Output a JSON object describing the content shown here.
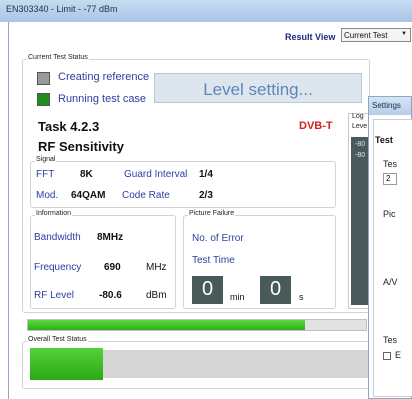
{
  "window": {
    "title": "EN303340 - Limit - -77 dBm"
  },
  "header": {
    "result_view_label": "Result View",
    "result_view_value": "Current Test"
  },
  "current_status": {
    "group_label": "Current Test Status",
    "steps": [
      {
        "label": "Creating reference",
        "checked": false,
        "color": "#9a9a9a"
      },
      {
        "label": "Running test case",
        "checked": true,
        "color": "#1e8f1e"
      }
    ],
    "level_text": "Level setting...",
    "task": "Task 4.2.3",
    "standard": "DVB-T",
    "test_name": "RF Sensitivity"
  },
  "signal": {
    "group_label": "Signal",
    "fft_label": "FFT",
    "fft_value": "8K",
    "guard_label": "Guard Interval",
    "guard_value": "1/4",
    "mod_label": "Mod.",
    "mod_value": "64QAM",
    "code_label": "Code Rate",
    "code_value": "2/3"
  },
  "information": {
    "group_label": "Information",
    "bandwidth_label": "Bandwidth",
    "bandwidth_value": "8MHz",
    "frequency_label": "Frequency",
    "frequency_value": "690",
    "frequency_unit": "MHz",
    "rflevel_label": "RF Level",
    "rflevel_value": "-80.6",
    "rflevel_unit": "dBm"
  },
  "picture_failure": {
    "group_label": "Picture Failure",
    "errors_label": "No. of Error",
    "time_label": "Test Time",
    "minutes": "0",
    "min_unit": "min",
    "seconds": "0",
    "sec_unit": "s"
  },
  "log": {
    "label_line1": "Log",
    "label_line2": "Leve",
    "entries": [
      "-80",
      "-80"
    ]
  },
  "progress": {
    "fraction": 0.82
  },
  "overall": {
    "group_label": "Overall Test Status",
    "fraction": 0.2
  },
  "settings_dialog": {
    "title": "Settings",
    "heading": "Test",
    "field1_label": "Tes",
    "field1_value": "2",
    "pic_label": "Pic",
    "av_label": "A/V",
    "test2_label": "Tes",
    "check_label": "E"
  }
}
